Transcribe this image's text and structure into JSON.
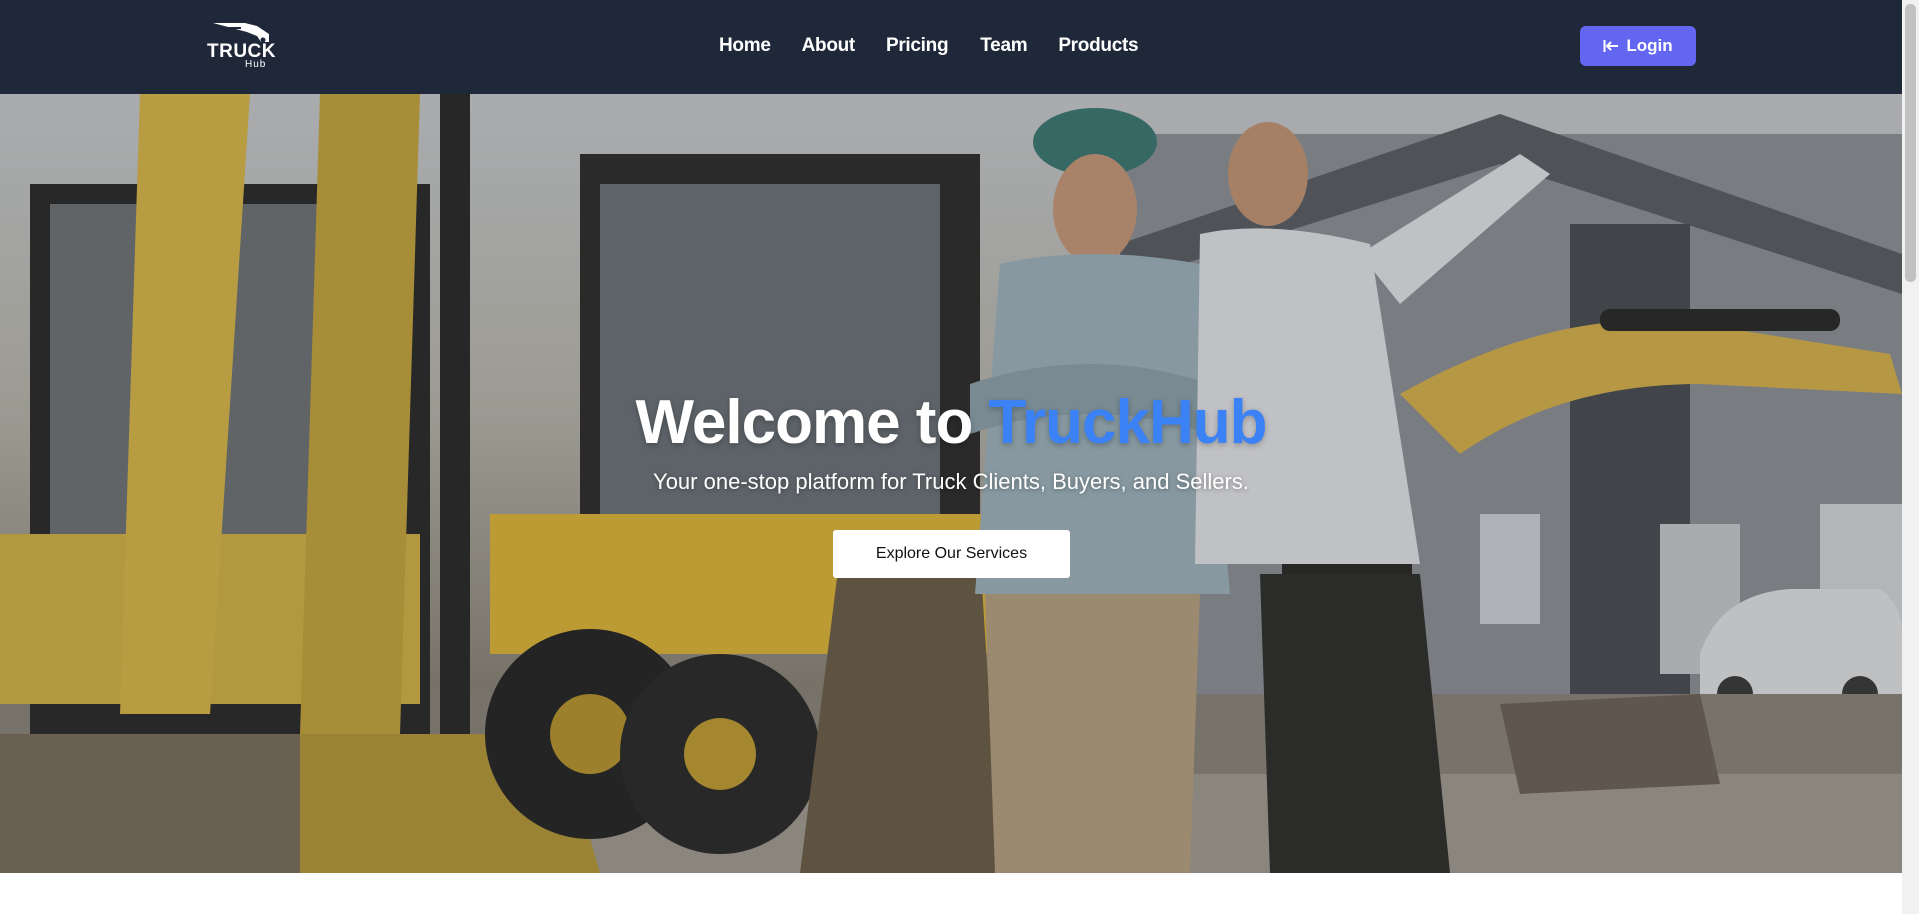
{
  "navbar": {
    "logo": {
      "word": "TRUCK",
      "sub": "Hub"
    },
    "links": [
      "Home",
      "About",
      "Pricing",
      "Team",
      "Products"
    ],
    "login_label": "Login"
  },
  "hero": {
    "title_prefix": "Welcome to ",
    "title_brand": "TruckHub",
    "subtitle": "Your one-stop platform for Truck Clients, Buyers, and Sellers.",
    "cta_label": "Explore Our Services"
  },
  "colors": {
    "navbar_bg": "#1f2838",
    "accent": "#6366f1",
    "brand_blue": "#3b82f6"
  },
  "icons": {
    "login": "login-arrow-icon",
    "logo": "truck-logo-icon"
  }
}
